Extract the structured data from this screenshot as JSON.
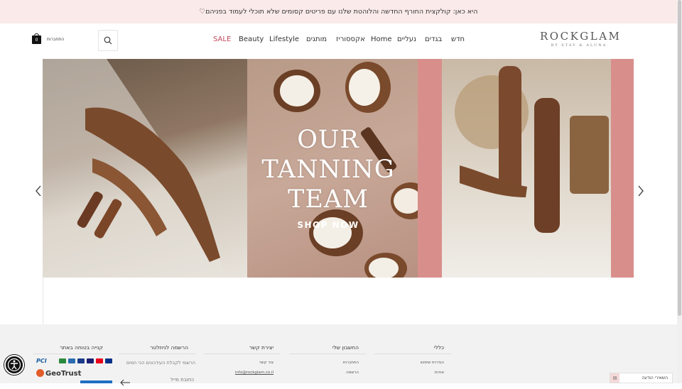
{
  "announcement": {
    "text": "היא כאן: קולקצית החורף החדשה והלוהטת שלנו עם פריטים קסומים שלא תוכלי לעמוד בפניהם♡"
  },
  "header": {
    "logo": {
      "main": "ROCKGLAM",
      "sub": "BY STAV & ALUNA"
    },
    "nav": [
      "חדש",
      "בגדים",
      "נעליים",
      "Home",
      "אקססוריז",
      "מותגים",
      "Lifestyle",
      "Beauty",
      "SALE"
    ],
    "login_label": "התחברות",
    "cart_count": "0",
    "search_icon": "search-icon"
  },
  "hero": {
    "headline_lines": [
      "OUR",
      "TANNING",
      "TEAM"
    ],
    "cta": "SHOP NOW",
    "colors": {
      "frame": "#d88f8b"
    }
  },
  "footer": {
    "columns": [
      {
        "title": "כללי",
        "links": [
          "הגדרות שימוש",
          "אודות"
        ]
      },
      {
        "title": "החשבון שלי",
        "links": [
          "התחברות",
          "הרשמה"
        ]
      },
      {
        "title": "יצירת קשר",
        "links": [
          "צור קשר",
          "info@rockglam.co.il"
        ]
      },
      {
        "title": "הרשמה לניוזלטר",
        "text": "הרשמי לקבלת העידכונים הכי חמים",
        "email_placeholder": "כתובת מייל"
      },
      {
        "title": "קנייה בטוחה באתר"
      }
    ],
    "badges": {
      "geotrust": "GeoTrust",
      "pci": "PCI"
    }
  },
  "chat": {
    "label": "השאירי הודעה"
  }
}
